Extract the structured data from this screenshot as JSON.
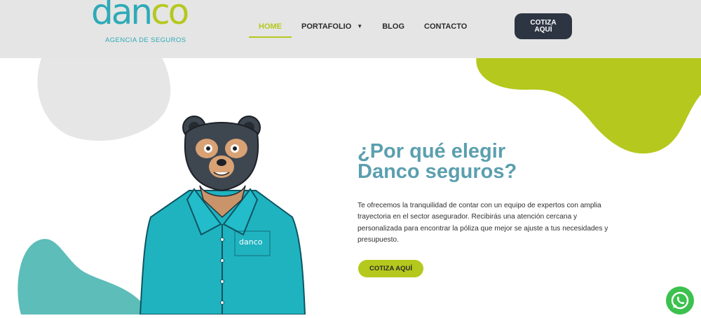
{
  "logo": {
    "word_part1": "dan",
    "word_part2": "co",
    "tagline": "AGENCIA DE SEGUROS"
  },
  "nav": {
    "items": [
      {
        "label": "HOME",
        "active": true
      },
      {
        "label": "PORTAFOLIO",
        "dropdown": true
      },
      {
        "label": "BLOG"
      },
      {
        "label": "CONTACTO"
      }
    ]
  },
  "header_cta": {
    "label": "COTIZA AQUÍ"
  },
  "hero": {
    "title_line1": "¿Por qué elegir",
    "title_line2": "Danco seguros?",
    "description": "Te ofrecemos la tranquilidad de contar con un equipo de expertos con amplia trayectoria en el sector asegurador. Recibirás una atención cercana y personalizada para encontrar la póliza que mejor se ajuste a tus necesidades y presupuesto.",
    "cta_label": "COTIZA AQUÍ"
  },
  "mascot": {
    "shirt_logo": "danco"
  },
  "colors": {
    "teal": "#2eaab7",
    "lime": "#b5c81d",
    "dark": "#2d3543",
    "title": "#5b9faf",
    "whatsapp": "#3cc14f"
  },
  "icons": {
    "dropdown": "chevron-down-icon",
    "whatsapp": "whatsapp-icon"
  }
}
